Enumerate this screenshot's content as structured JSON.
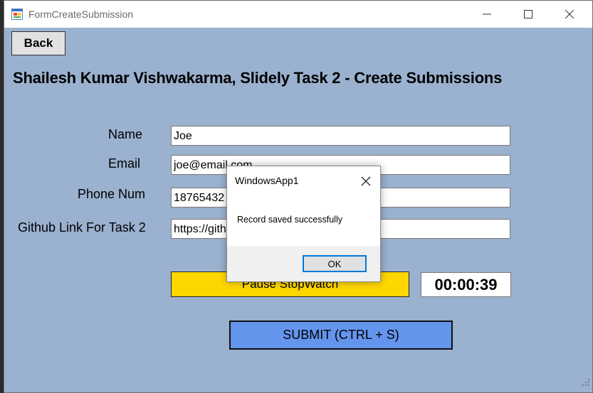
{
  "window": {
    "title": "FormCreateSubmission",
    "icon": "windows-form-icon",
    "controls": [
      "minimize-icon",
      "maximize-icon",
      "close-icon"
    ]
  },
  "form": {
    "back_label": "Back",
    "heading": "Shailesh Kumar Vishwakarma, Slidely Task 2 - Create Submissions",
    "fields": [
      {
        "label": "Name",
        "value": "Joe"
      },
      {
        "label": "Email",
        "value": "joe@email.com"
      },
      {
        "label": "Phone Num",
        "value": "18765432"
      },
      {
        "label": "Github Link For Task 2",
        "value": "https://gith"
      }
    ],
    "pause_label": "Pause StopWatch",
    "timer": "00:00:39",
    "submit_label": "SUBMIT (CTRL + S)"
  },
  "dialog": {
    "title": "WindowsApp1",
    "message": "Record saved successfully",
    "ok_label": "OK"
  },
  "colors": {
    "form_background": "#9ab1cf",
    "pause_button": "#ffd700",
    "submit_button": "#6495ed",
    "dialog_focus": "#0078d7"
  }
}
